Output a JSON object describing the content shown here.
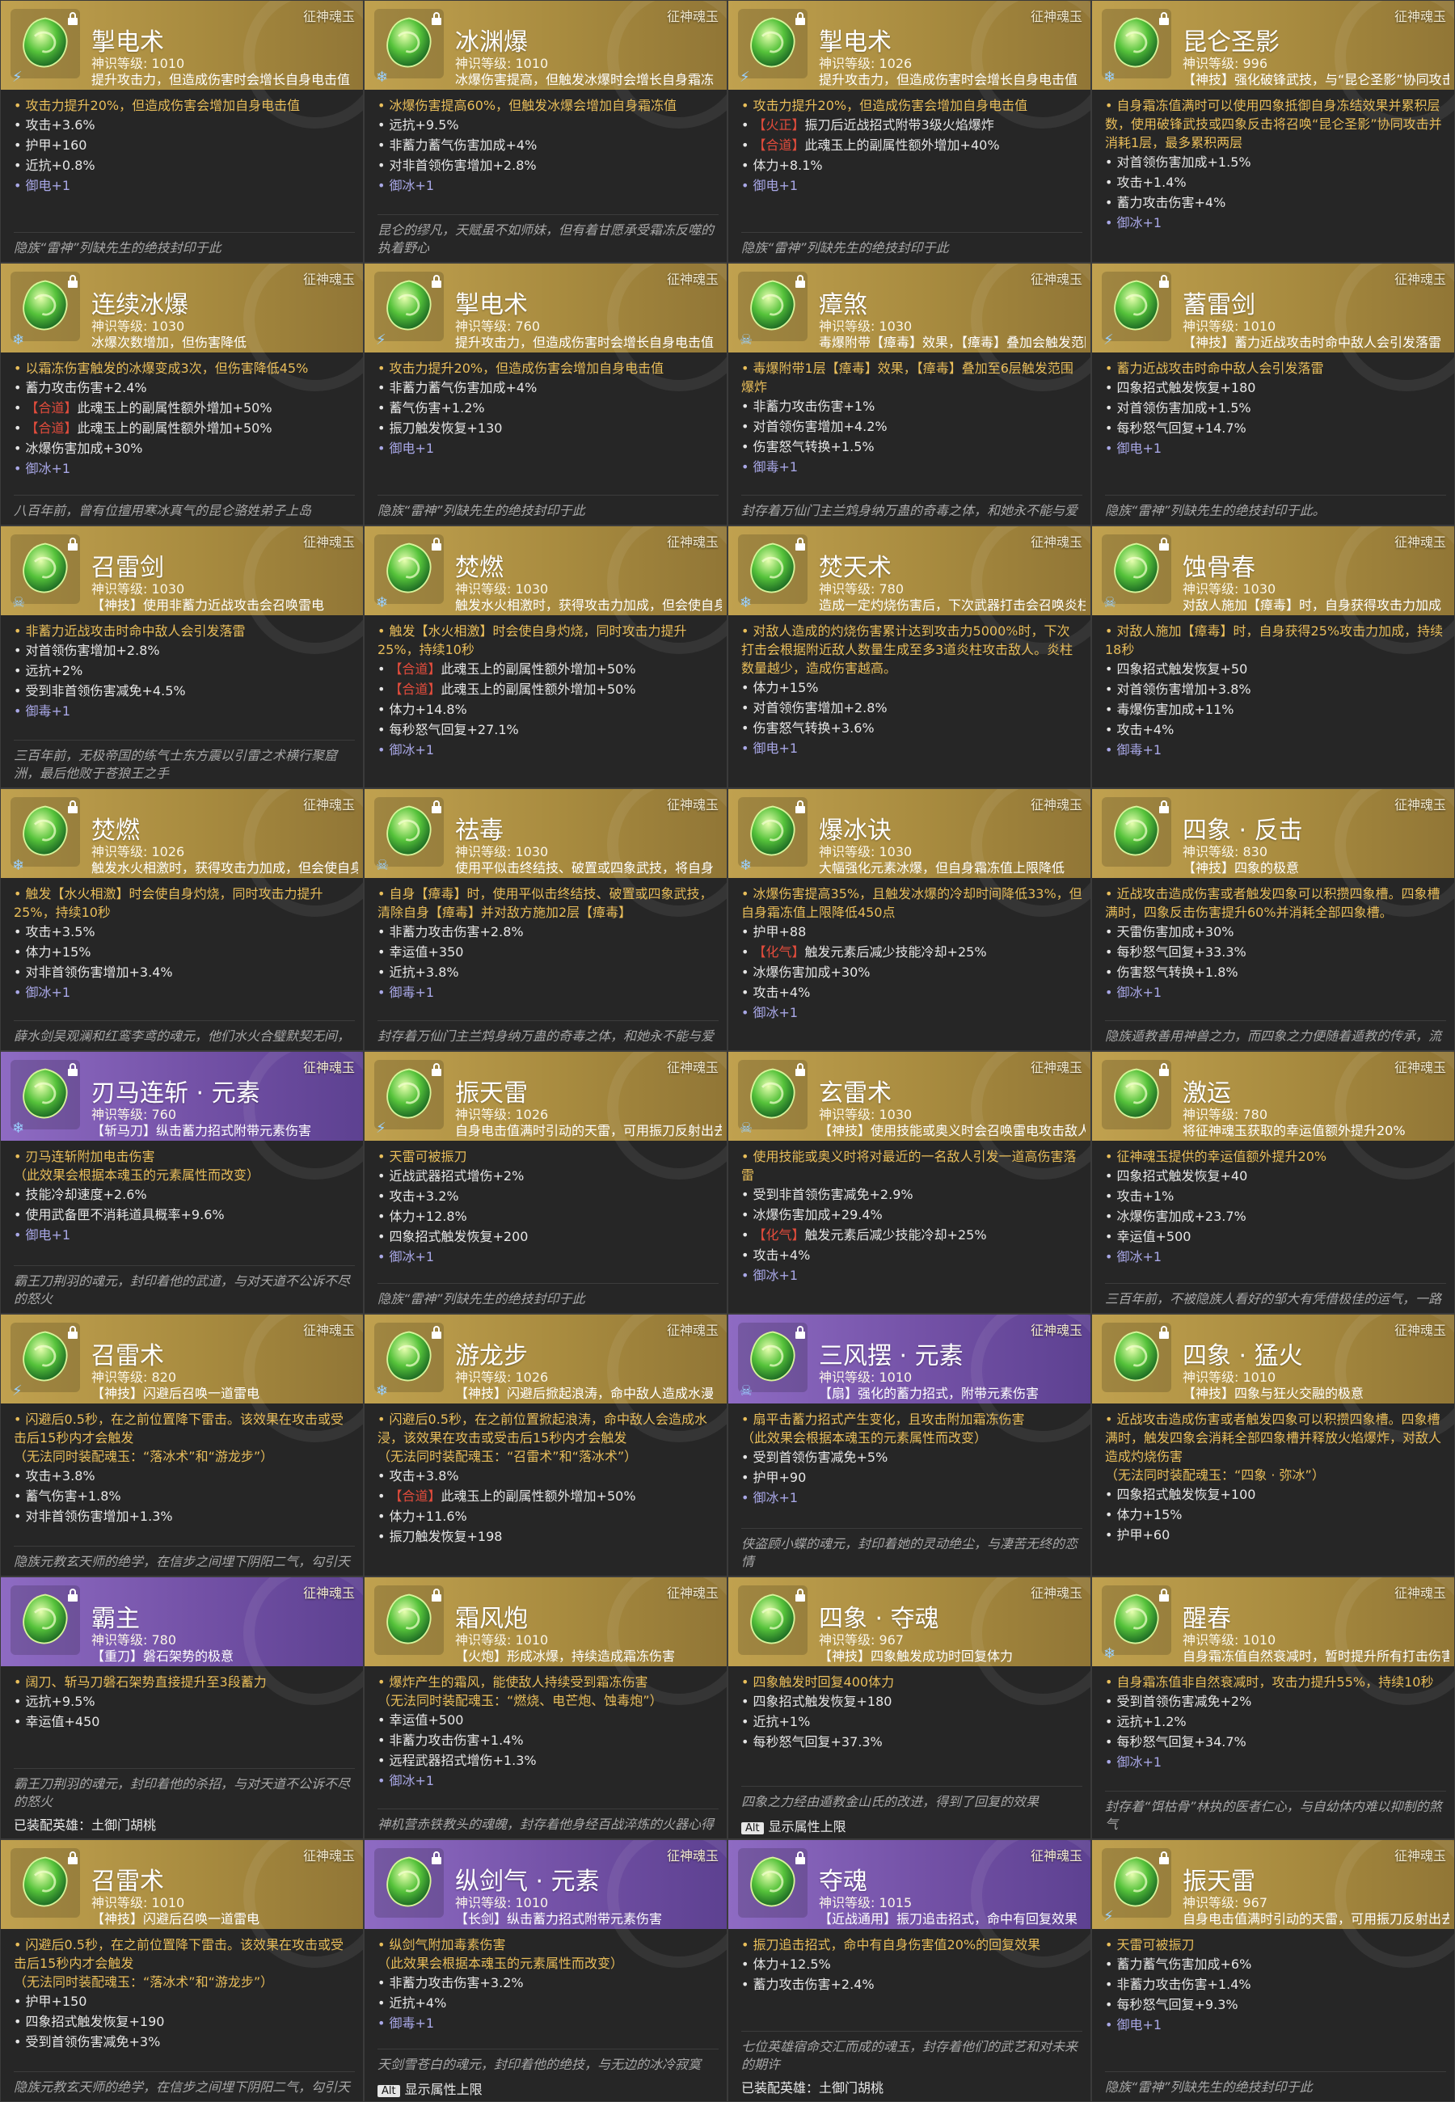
{
  "colors": {
    "gold": "#c0a14f",
    "purple": "#8e6bc3",
    "main_effect": "#e9be5a",
    "tag_red": "#e24c3c",
    "stat": "#e6e6e6",
    "footer_violet": "#a8a7e6"
  },
  "badge": "征神魂玉",
  "cards": [
    {
      "theme": "gold",
      "icon": "jade-gem-icon",
      "element": "⚡",
      "name": "掣电术",
      "level": "神识等级: 1010",
      "summary": "提升攻击力，但造成伤害时会增长自身电击值",
      "main": "• 攻击力提升20%，但造成伤害会增加自身电击值",
      "stats": [
        "• 攻击+3.6%",
        "• 护甲+160",
        "• 近抗+0.8%"
      ],
      "footer": "• 御电+1",
      "lore": "隐族“雷神”列缺先生的绝技封印于此"
    },
    {
      "theme": "gold",
      "icon": "jade-gem-icon",
      "element": "❄",
      "name": "冰渊爆",
      "level": "神识等级: 1010",
      "summary": "冰爆伤害提高，但触发冰爆时会增长自身霜冻",
      "main": "• 冰爆伤害提高60%，但触发冰爆会增加自身霜冻值",
      "stats": [
        "• 远抗+9.5%",
        "• 非蓄力蓄气伤害加成+4%",
        "• 对非首领伤害增加+2.8%"
      ],
      "footer": "• 御冰+1",
      "lore": "昆仑的缪凡，天赋虽不如师妹，但有着甘愿承受霜冻反噬的执着野心"
    },
    {
      "theme": "gold",
      "icon": "jade-gem-icon",
      "element": "⚡",
      "name": "掣电术",
      "level": "神识等级: 1026",
      "summary": "提升攻击力，但造成伤害时会增长自身电击值",
      "main": "• 攻击力提升20%，但造成伤害会增加自身电击值",
      "stats": [
        "• 【火正】振刀后近战招式附带3级火焰爆炸",
        "• 【合道】此魂玉上的副属性额外增加+40%",
        "• 体力+8.1%"
      ],
      "footer": "• 御电+1",
      "lore": "隐族“雷神”列缺先生的绝技封印于此"
    },
    {
      "theme": "gold",
      "icon": "jade-gem-icon",
      "element": "❄",
      "name": "昆仑圣影",
      "level": "神识等级: 996",
      "summary": "【神技】强化破锋武技，与“昆仑圣影”协同攻击",
      "main": "• 自身霜冻值满时可以使用四象抵御自身冻结效果并累积层数，使用破锋武技或四象反击将召唤“昆仑圣影”协同攻击并消耗1层，最多累积两层",
      "stats": [
        "• 对首领伤害加成+1.5%",
        "• 攻击+1.4%",
        "• 蓄力攻击伤害+4%"
      ],
      "footer": "• 御冰+1",
      "lore": ""
    },
    {
      "theme": "gold",
      "icon": "jade-gem-icon",
      "element": "❄",
      "name": "连续冰爆",
      "level": "神识等级: 1030",
      "summary": "冰爆次数增加，但伤害降低",
      "main": "• 以霜冻伤害触发的冰爆变成3次，但伤害降低45%",
      "stats": [
        "• 蓄力攻击伤害+2.4%",
        "• 【合道】此魂玉上的副属性额外增加+50%",
        "• 【合道】此魂玉上的副属性额外增加+50%",
        "• 冰爆伤害加成+30%"
      ],
      "footer": "• 御冰+1",
      "lore": "八百年前，曾有位擅用寒冰真气的昆仑骆姓弟子上岛"
    },
    {
      "theme": "gold",
      "icon": "jade-gem-icon",
      "element": "⚡",
      "name": "掣电术",
      "level": "神识等级: 760",
      "summary": "提升攻击力，但造成伤害时会增长自身电击值",
      "main": "• 攻击力提升20%，但造成伤害会增加自身电击值",
      "stats": [
        "• 非蓄力蓄气伤害加成+4%",
        "• 蓄气伤害+1.2%",
        "• 振刀触发恢复+130"
      ],
      "footer": "• 御电+1",
      "lore": "隐族“雷神”列缺先生的绝技封印于此"
    },
    {
      "theme": "gold",
      "icon": "jade-gem-icon",
      "element": "☠",
      "name": "瘴煞",
      "level": "神识等级: 1030",
      "summary": "毒爆附带【瘴毒】效果，【瘴毒】叠加会触发范围",
      "main": "• 毒爆附带1层【瘴毒】效果，【瘴毒】叠加至6层触发范围爆炸",
      "stats": [
        "• 非蓄力攻击伤害+1%",
        "• 对首领伤害增加+4.2%",
        "• 伤害怒气转换+1.5%"
      ],
      "footer": "• 御毒+1",
      "lore": "封存着万仙门主兰鸩身纳万蛊的奇毒之体，和她永不能与爱"
    },
    {
      "theme": "gold",
      "icon": "jade-gem-icon",
      "element": "⚡",
      "name": "蓄雷剑",
      "level": "神识等级: 1010",
      "summary": "【神技】蓄力近战攻击时命中敌人会引发落雷",
      "main": "• 蓄力近战攻击时命中敌人会引发落雷",
      "stats": [
        "• 四象招式触发恢复+180",
        "• 对首领伤害加成+1.5%",
        "• 每秒怒气回复+14.7%"
      ],
      "footer": "• 御电+1",
      "lore": "隐族“雷神”列缺先生的绝技封印于此。"
    },
    {
      "theme": "gold",
      "icon": "jade-gem-icon",
      "element": "☠",
      "name": "召雷剑",
      "level": "神识等级: 1030",
      "summary": "【神技】使用非蓄力近战攻击会召唤雷电",
      "main": "• 非蓄力近战攻击时命中敌人会引发落雷",
      "stats": [
        "• 对首领伤害增加+2.8%",
        "• 远抗+2%",
        "• 受到非首领伤害减免+4.5%"
      ],
      "footer": "• 御毒+1",
      "lore": "三百年前，无极帝国的练气士东方震以引雷之术横行聚窟洲，最后他败于苍狼王之手"
    },
    {
      "theme": "gold",
      "icon": "jade-gem-icon",
      "element": "❄",
      "name": "焚燃",
      "level": "神识等级: 1030",
      "summary": "触发水火相激时，获得攻击力加成，但会使自身灼烧",
      "main": "• 触发【水火相激】时会使自身灼烧，同时攻击力提升25%，持续10秒",
      "stats": [
        "• 【合道】此魂玉上的副属性额外增加+50%",
        "• 【合道】此魂玉上的副属性额外增加+50%",
        "• 体力+14.8%",
        "• 每秒怒气回复+27.1%"
      ],
      "footer": "• 御冰+1",
      "lore": ""
    },
    {
      "theme": "gold",
      "icon": "jade-gem-icon",
      "element": "❄",
      "name": "焚天术",
      "level": "神识等级: 780",
      "summary": "造成一定灼烧伤害后，下次武器打击会召唤炎柱攻击敌人",
      "main": "• 对敌人造成的灼烧伤害累计达到攻击力5000%时，下次打击会根据附近敌人数量生成至多3道炎柱攻击敌人。炎柱数量越少，造成伤害越高。",
      "stats": [
        "• 体力+15%",
        "• 对首领伤害增加+2.8%",
        "• 伤害怒气转换+3.6%"
      ],
      "footer": "• 御电+1",
      "lore": ""
    },
    {
      "theme": "gold",
      "icon": "jade-gem-icon",
      "element": "☠",
      "name": "蚀骨春",
      "level": "神识等级: 1030",
      "summary": "对敌人施加【瘴毒】时，自身获得攻击力加成",
      "main": "• 对敌人施加【瘴毒】时，自身获得25%攻击力加成，持续18秒",
      "stats": [
        "• 四象招式触发恢复+50",
        "• 对首领伤害增加+3.8%",
        "• 毒爆伤害加成+11%",
        "• 攻击+4%"
      ],
      "footer": "• 御毒+1",
      "lore": ""
    },
    {
      "theme": "gold",
      "icon": "jade-gem-icon",
      "element": "❄",
      "name": "焚燃",
      "level": "神识等级: 1026",
      "summary": "触发水火相激时，获得攻击力加成，但会使自身灼烧",
      "main": "• 触发【水火相激】时会使自身灼烧，同时攻击力提升25%，持续10秒",
      "stats": [
        "• 攻击+3.5%",
        "• 体力+15%",
        "• 对非首领伤害增加+3.4%"
      ],
      "footer": "• 御冰+1",
      "lore": "薛水剑吴观澜和红鸾李鸢的魂元，他们水火合璧默契无间，"
    },
    {
      "theme": "gold",
      "icon": "jade-leaf-icon",
      "element": "☠",
      "name": "祛毒",
      "level": "神识等级: 1030",
      "summary": "使用平似击终结技、破置或四象武技，将自身【瘴毒】转移给敌人",
      "main": "• 自身【瘴毒】时，使用平似击终结技、破置或四象武技，清除自身【瘴毒】并对敌方施加2层【瘴毒】",
      "stats": [
        "• 非蓄力攻击伤害+2.8%",
        "• 幸运值+350",
        "• 近抗+3.8%"
      ],
      "footer": "• 御毒+1",
      "lore": "封存着万仙门主兰鸩身纳万蛊的奇毒之体，和她永不能与爱"
    },
    {
      "theme": "gold",
      "icon": "jade-gem-icon",
      "element": "❄",
      "name": "爆冰诀",
      "level": "神识等级: 1030",
      "summary": "大幅强化元素冰爆，但自身霜冻值上限降低",
      "main": "• 冰爆伤害提高35%，且触发冰爆的冷却时间降低33%，但自身霜冻值上限降低450点",
      "stats": [
        "• 护甲+88",
        "• 【化气】触发元素后减少技能冷却+25%",
        "• 冰爆伤害加成+30%",
        "• 攻击+4%"
      ],
      "footer": "• 御冰+1",
      "lore": ""
    },
    {
      "theme": "gold",
      "icon": "jade-butterfly-icon",
      "element": "",
      "name": "四象 · 反击",
      "level": "神识等级: 830",
      "summary": "【神技】四象的极意",
      "main": "• 近战攻击造成伤害或者触发四象可以积攒四象槽。四象槽满时，四象反击伤害提升60%并消耗全部四象槽。",
      "stats": [
        "• 天雷伤害加成+30%",
        "• 每秒怒气回复+33.3%",
        "• 伤害怒气转换+1.8%"
      ],
      "footer": "• 御冰+1",
      "lore": "隐族遁教善用神兽之力，而四象之力便随着遁教的传承，流"
    },
    {
      "theme": "purple",
      "icon": "jade-gem-icon",
      "element": "❄",
      "name": "刃马连斩 · 元素",
      "level": "神识等级: 760",
      "summary": "【斩马刀】纵击蓄力招式附带元素伤害",
      "main": "• 刃马连斩附加电击伤害\n（此效果会根据本魂玉的元素属性而改变）",
      "stats": [
        "• 技能冷却速度+2.6%",
        "• 使用武备匣不消耗道具概率+9.6%"
      ],
      "footer": "• 御电+1",
      "lore": "霸王刀荆羽的魂元，封印着他的武道，与对天道不公诉不尽的怒火"
    },
    {
      "theme": "gold",
      "icon": "jade-leaf-icon",
      "element": "⚡",
      "name": "振天雷",
      "level": "神识等级: 1026",
      "summary": "自身电击值满时引动的天雷，可用振刀反射出去",
      "main": "• 天雷可被振刀",
      "stats": [
        "• 近战武器招式增伤+2%",
        "• 攻击+3.2%",
        "• 体力+12.8%",
        "• 四象招式触发恢复+200"
      ],
      "footer": "• 御冰+1",
      "lore": "隐族“雷神”列缺先生的绝技封印于此"
    },
    {
      "theme": "gold",
      "icon": "jade-leaf-icon",
      "element": "☠",
      "name": "玄雷术",
      "level": "神识等级: 1030",
      "summary": "【神技】使用技能或奥义时会召唤雷电攻击敌人",
      "main": "• 使用技能或奥义时将对最近的一名敌人引发一道高伤害落雷",
      "stats": [
        "• 受到非首领伤害减免+2.9%",
        "• 冰爆伤害加成+29.4%",
        "• 【化气】触发元素后减少技能冷却+25%",
        "• 攻击+4%"
      ],
      "footer": "• 御冰+1",
      "lore": ""
    },
    {
      "theme": "gold",
      "icon": "jade-wing-icon",
      "element": "",
      "name": "激运",
      "level": "神识等级: 780",
      "summary": "将征神魂玉获取的幸运值额外提升20%",
      "main": "• 征神魂玉提供的幸运值额外提升20%",
      "stats": [
        "• 四象招式触发恢复+40",
        "• 攻击+1%",
        "• 冰爆伤害加成+23.7%",
        "• 幸运值+500"
      ],
      "footer": "• 御冰+1",
      "lore": "三百年前，不被隐族人看好的邹大有凭借极佳的运气，一路"
    },
    {
      "theme": "gold",
      "icon": "jade-leaf-icon",
      "element": "⚡",
      "name": "召雷术",
      "level": "神识等级: 820",
      "summary": "【神技】闪避后召唤一道雷电",
      "main": "• 闪避后0.5秒，在之前位置降下雷击。该效果在攻击或受击后15秒内才会触发\n（无法同时装配魂玉：“落冰术”和“游龙步”）",
      "stats": [
        "• 攻击+3.8%",
        "• 蓄气伤害+1.8%",
        "• 对非首领伤害增加+1.3%"
      ],
      "footer": "",
      "lore": "隐族元教玄天师的绝学，在信步之间埋下阴阳二气，勾引天"
    },
    {
      "theme": "gold",
      "icon": "jade-leaf-icon",
      "element": "❄",
      "name": "游龙步",
      "level": "神识等级: 1026",
      "summary": "【神技】闪避后掀起浪涛，命中敌人造成水漫",
      "main": "• 闪避后0.5秒，在之前位置掀起浪涛，命中敌人会造成水浸，该效果在攻击或受击后15秒内才会触发\n（无法同时装配魂玉：“召雷术”和“落冰术”）",
      "stats": [
        "• 攻击+3.8%",
        "• 【合道】此魂玉上的副属性额外增加+50%",
        "• 体力+11.6%",
        "• 振刀触发恢复+198"
      ],
      "footer": "",
      "lore": ""
    },
    {
      "theme": "purple",
      "icon": "jade-gem-icon",
      "element": "☠",
      "name": "三风摆 · 元素",
      "level": "神识等级: 1010",
      "summary": "【扇】强化的蓄力招式，附带元素伤害",
      "main": "• 扇平击蓄力招式产生变化，且攻击附加霜冻伤害\n（此效果会根据本魂玉的元素属性而改变）",
      "stats": [
        "• 受到首领伤害减免+5%",
        "• 护甲+90"
      ],
      "footer": "• 御冰+1",
      "lore": "侠盗顾小蝶的魂元，封印着她的灵动绝尘，与凄苦无终的恋情"
    },
    {
      "theme": "gold",
      "icon": "jade-butterfly-icon",
      "element": "",
      "name": "四象 · 猛火",
      "level": "神识等级: 1010",
      "summary": "【神技】四象与狂火交融的极意",
      "main": "• 近战攻击造成伤害或者触发四象可以积攒四象槽。四象槽满时，触发四象会消耗全部四象槽并释放火焰爆炸，对敌人造成灼烧伤害\n（无法同时装配魂玉：“四象 · 弥冰”）",
      "stats": [
        "• 四象招式触发恢复+100",
        "• 体力+15%",
        "• 护甲+60"
      ],
      "footer": "",
      "lore": ""
    },
    {
      "theme": "purple",
      "icon": "jade-leaf-icon",
      "element": "",
      "name": "霸主",
      "level": "神识等级: 780",
      "summary": "【重刀】磐石架势的极意",
      "main": "• 阔刀、斩马刀磐石架势直接提升至3段蓄力",
      "stats": [
        "• 远抗+9.5%",
        "• 幸运值+450"
      ],
      "footer": "",
      "lore": "霸王刀荆羽的魂元，封印着他的杀招，与对天道不公诉不尽的怒火",
      "equip": "已装配英雄：土御门胡桃"
    },
    {
      "theme": "gold",
      "icon": "jade-coil-icon",
      "element": "",
      "name": "霜风炮",
      "level": "神识等级: 1010",
      "summary": "【火炮】形成冰爆，持续造成霜冻伤害",
      "main": "• 爆炸产生的霜风，能使敌人持续受到霜冻伤害\n（无法同时装配魂玉：“燃烧、电芒炮、蚀毒炮”）",
      "stats": [
        "• 幸运值+500",
        "• 非蓄力攻击伤害+1.4%",
        "• 远程武器招式增伤+1.3%"
      ],
      "footer": "• 御冰+1",
      "lore": "神机营赤铁教头的魂魄，封存着他身经百战淬炼的火器心得"
    },
    {
      "theme": "gold",
      "icon": "jade-butterfly-icon",
      "element": "",
      "name": "四象 · 夺魂",
      "level": "神识等级: 967",
      "summary": "【神技】四象触发成功时回复体力",
      "main": "• 四象触发时回复400体力",
      "stats": [
        "• 四象招式触发恢复+180",
        "• 近抗+1%",
        "• 每秒怒气回复+37.3%"
      ],
      "footer": "",
      "lore": "四象之力经由遁教金山氏的改进，得到了回复的效果",
      "alt": "显示属性上限"
    },
    {
      "theme": "gold",
      "icon": "jade-leaf-icon",
      "element": "❄",
      "name": "醒春",
      "level": "神识等级: 1010",
      "summary": "自身霜冻值自然衰减时，暂时提升所有打击伤害",
      "main": "• 自身霜冻值非自然衰减时，攻击力提升55%，持续10秒",
      "stats": [
        "• 受到首领伤害减免+2%",
        "• 远抗+1.2%",
        "• 每秒怒气回复+34.7%"
      ],
      "footer": "• 御冰+1",
      "lore": "封存着“饵枯骨”林执的医者仁心，与自幼体内难以抑制的煞气"
    },
    {
      "theme": "gold",
      "icon": "jade-leaf-icon",
      "element": "",
      "name": "召雷术",
      "level": "神识等级: 1010",
      "summary": "【神技】闪避后召唤一道雷电",
      "main": "• 闪避后0.5秒，在之前位置降下雷击。该效果在攻击或受击后15秒内才会触发\n（无法同时装配魂玉：“落冰术”和“游龙步”）",
      "stats": [
        "• 护甲+150",
        "• 四象招式触发恢复+190",
        "• 受到首领伤害减免+3%"
      ],
      "footer": "",
      "lore": "隐族元教玄天师的绝学，在信步之间埋下阴阳二气，勾引天"
    },
    {
      "theme": "purple",
      "icon": "jade-gem-icon",
      "element": "",
      "name": "纵剑气 · 元素",
      "level": "神识等级: 1010",
      "summary": "【长剑】纵击蓄力招式附带元素伤害",
      "main": "• 纵剑气附加毒素伤害\n（此效果会根据本魂玉的元素属性而改变）",
      "stats": [
        "• 非蓄力攻击伤害+3.2%",
        "• 近抗+4%"
      ],
      "footer": "• 御毒+1",
      "lore": "天剑雪苍白的魂元，封印着他的绝技，与无边的冰冷寂寞",
      "alt": "显示属性上限"
    },
    {
      "theme": "purple",
      "icon": "jade-leaf-icon",
      "element": "",
      "name": "夺魂",
      "level": "神识等级: 1015",
      "summary": "【近战通用】振刀追击招式，命中有回复效果",
      "main": "• 振刀追击招式，命中有自身伤害值20%的回复效果",
      "stats": [
        "• 体力+12.5%",
        "• 蓄力攻击伤害+2.4%"
      ],
      "footer": "",
      "lore": "七位英雄宿命交汇而成的魂玉，封存着他们的武艺和对未来的期许",
      "equip": "已装配英雄：土御门胡桃"
    },
    {
      "theme": "gold",
      "icon": "jade-leaf-icon",
      "element": "⚡",
      "name": "振天雷",
      "level": "神识等级: 967",
      "summary": "自身电击值满时引动的天雷，可用振刀反射出去",
      "main": "• 天雷可被振刀",
      "stats": [
        "• 蓄力蓄气伤害加成+6%",
        "• 非蓄力攻击伤害+1.4%",
        "• 每秒怒气回复+9.3%"
      ],
      "footer": "• 御电+1",
      "lore": "隐族“雷神”列缺先生的绝技封印于此"
    }
  ]
}
